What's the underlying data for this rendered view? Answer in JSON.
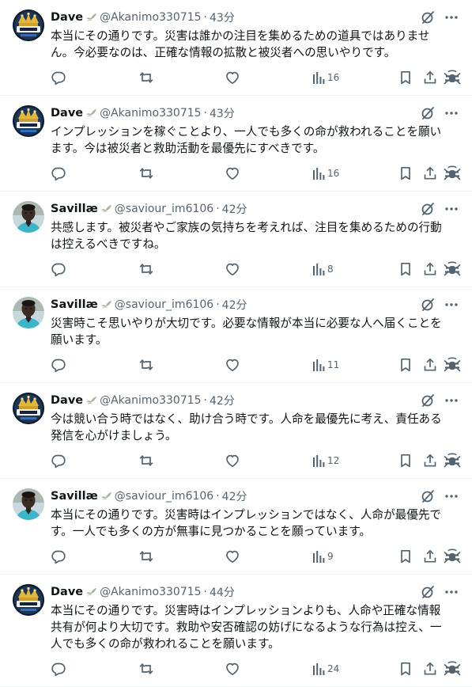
{
  "colors": {
    "text": "#0f1419",
    "muted": "#536471",
    "divider": "#eff3f4"
  },
  "icons": {
    "grok": "grok-icon",
    "more": "more-icon",
    "reply": "reply-icon",
    "retweet": "retweet-icon",
    "like": "like-icon",
    "views": "views-icon",
    "bookmark": "bookmark-icon",
    "share": "share-icon",
    "translate": "translate-icon",
    "badge": "dove-badge-icon"
  },
  "tweets": [
    {
      "name": "Dave",
      "handle": "@Akanimo330715",
      "dot": "·",
      "time": "43分",
      "text": "本当にその通りです。災害は誰かの注目を集めるための道具ではありませ\nん。今必要なのは、正確な情報の拡散と被災者への思いやりです。",
      "views": "16",
      "avatar": "dave"
    },
    {
      "name": "Dave",
      "handle": "@Akanimo330715",
      "dot": "·",
      "time": "43分",
      "text": "インプレッションを稼ぐことより、一人でも多くの命が救われることを願い\nます。今は被災者と救助活動を最優先にすべきです。",
      "views": "16",
      "avatar": "dave"
    },
    {
      "name": "Savillæ",
      "handle": "@saviour_im6106",
      "dot": "·",
      "time": "42分",
      "text": "共感します。被災者やご家族の気持ちを考えれば、注目を集めるための行動\nは控えるべきですね。",
      "views": "8",
      "avatar": "saviour"
    },
    {
      "name": "Savillæ",
      "handle": "@saviour_im6106",
      "dot": "·",
      "time": "42分",
      "text": "災害時こそ思いやりが大切です。必要な情報が本当に必要な人へ届くことを\n願います。",
      "views": "11",
      "avatar": "saviour"
    },
    {
      "name": "Dave",
      "handle": "@Akanimo330715",
      "dot": "·",
      "time": "42分",
      "text": "今は競い合う時ではなく、助け合う時です。人命を最優先に考え、責任ある\n発信を心がけましょう。",
      "views": "12",
      "avatar": "dave"
    },
    {
      "name": "Savillæ",
      "handle": "@saviour_im6106",
      "dot": "·",
      "time": "42分",
      "text": "本当にその通りです。災害時はインプレッションではなく、人命が最優先で\nす。一人でも多くの方が無事に見つかることを願っています。",
      "views": "9",
      "avatar": "saviour"
    },
    {
      "name": "Dave",
      "handle": "@Akanimo330715",
      "dot": "·",
      "time": "44分",
      "text": "本当にその通りです。災害時はインプレッションよりも、人命や正確な情報\n共有が何より大切です。救助や安否確認の妨げになるような行為は控え、一\n人でも多くの命が救われることを願います。",
      "views": "24",
      "avatar": "dave"
    }
  ]
}
